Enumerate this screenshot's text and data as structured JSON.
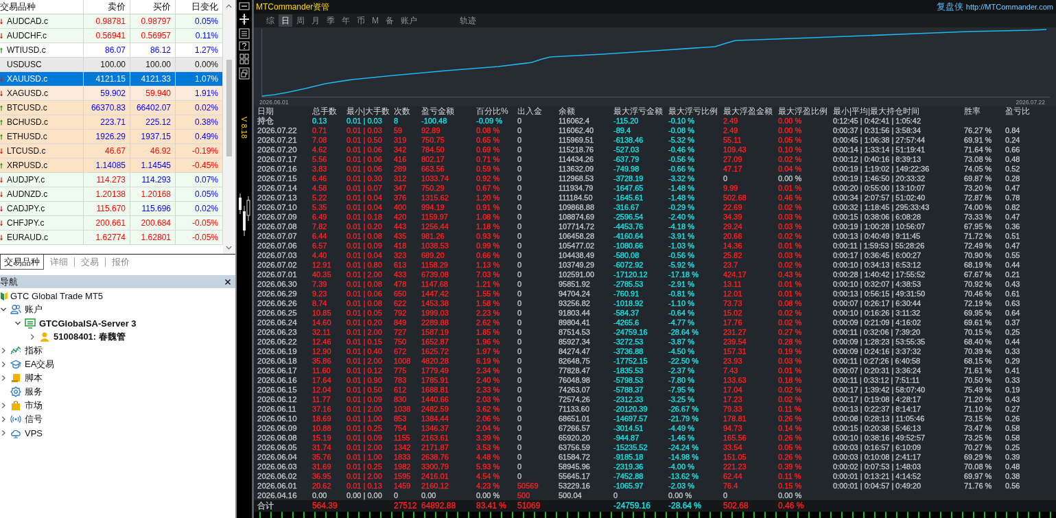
{
  "market_watch": {
    "columns": [
      "交易品种",
      "卖价",
      "买价",
      "日变化"
    ],
    "rows": [
      {
        "symbol": "AUDCAD.c",
        "bid": {
          "text": "0.98781",
          "color": "#ff0000"
        },
        "ask": {
          "text": "0.98797",
          "color": "#ff0000"
        },
        "change": {
          "text": "0.05%",
          "color": "#0000ff"
        },
        "rising": false,
        "color": "#eefbee",
        "selected": false
      },
      {
        "symbol": "AUDCHF.c",
        "bid": {
          "text": "0.56941",
          "color": "#ff0000"
        },
        "ask": {
          "text": "0.56957",
          "color": "#ff0000"
        },
        "change": {
          "text": "0.11%",
          "color": "#0000ff"
        },
        "rising": false,
        "color": "#eefbee",
        "selected": false
      },
      {
        "symbol": "WTIUSD.c",
        "bid": {
          "text": "86.07",
          "color": "#0000ff"
        },
        "ask": {
          "text": "86.12",
          "color": "#0000ff"
        },
        "change": {
          "text": "1.27%",
          "color": "#0000ff"
        },
        "rising": true,
        "color": "#ffffff",
        "selected": false
      },
      {
        "symbol": "USDUSC",
        "bid": {
          "text": "100.00",
          "color": "#111111"
        },
        "ask": {
          "text": "100.00",
          "color": "#111111"
        },
        "change": {
          "text": "0.00%",
          "color": "#111111"
        },
        "color": "#e8e8e8",
        "selected": false
      },
      {
        "symbol": "XAUUSD.c",
        "bid": "4121.15",
        "ask": "4121.33",
        "change": "1.07%",
        "rising": false,
        "selected": true
      },
      {
        "symbol": "XAGUSD.c",
        "bid": {
          "text": "59.902",
          "color": "#0000ff"
        },
        "ask": {
          "text": "59.940",
          "color": "#ff0000"
        },
        "change": {
          "text": "1.91%",
          "color": "#0000ff"
        },
        "rising": false,
        "color": "#fbe9da",
        "selected": false
      },
      {
        "symbol": "BTCUSD.c",
        "bid": {
          "text": "66370.83",
          "color": "#0000ff"
        },
        "ask": {
          "text": "66402.07",
          "color": "#0000ff"
        },
        "change": {
          "text": "0.02%",
          "color": "#0000ff"
        },
        "rising": true,
        "color": "#fde3c6",
        "selected": false
      },
      {
        "symbol": "BCHUSD.c",
        "bid": {
          "text": "223.71",
          "color": "#0000ff"
        },
        "ask": {
          "text": "225.12",
          "color": "#0000ff"
        },
        "change": {
          "text": "0.38%",
          "color": "#0000ff"
        },
        "rising": true,
        "color": "#fde3c6",
        "selected": false
      },
      {
        "symbol": "ETHUSD.c",
        "bid": {
          "text": "1926.29",
          "color": "#0000ff"
        },
        "ask": {
          "text": "1937.15",
          "color": "#0000ff"
        },
        "change": {
          "text": "0.49%",
          "color": "#0000ff"
        },
        "rising": true,
        "color": "#fde3c6",
        "selected": false
      },
      {
        "symbol": "LTCUSD.c",
        "bid": {
          "text": "46.67",
          "color": "#ff0000"
        },
        "ask": {
          "text": "46.92",
          "color": "#ff0000"
        },
        "change": {
          "text": "-0.19%",
          "color": "#ff0000"
        },
        "rising": false,
        "color": "#fde3c6",
        "selected": false
      },
      {
        "symbol": "XRPUSD.c",
        "bid": {
          "text": "1.14085",
          "color": "#0000ff"
        },
        "ask": {
          "text": "1.14545",
          "color": "#0000ff"
        },
        "change": {
          "text": "-0.45%",
          "color": "#ff0000"
        },
        "rising": true,
        "color": "#fde3c6",
        "selected": false
      },
      {
        "symbol": "AUDJPY.c",
        "bid": {
          "text": "114.273",
          "color": "#ff0000"
        },
        "ask": {
          "text": "114.293",
          "color": "#0000ff"
        },
        "change": {
          "text": "0.07%",
          "color": "#0000ff"
        },
        "rising": false,
        "color": "#eefbee",
        "selected": false
      },
      {
        "symbol": "AUDNZD.c",
        "bid": {
          "text": "1.20138",
          "color": "#ff0000"
        },
        "ask": {
          "text": "1.20168",
          "color": "#ff0000"
        },
        "change": {
          "text": "0.05%",
          "color": "#0000ff"
        },
        "rising": false,
        "color": "#eefbee",
        "selected": false
      },
      {
        "symbol": "CADJPY.c",
        "bid": {
          "text": "115.670",
          "color": "#ff0000"
        },
        "ask": {
          "text": "115.696",
          "color": "#0000ff"
        },
        "change": {
          "text": "0.02%",
          "color": "#0000ff"
        },
        "rising": false,
        "color": "#eefbee",
        "selected": false
      },
      {
        "symbol": "CHFJPY.c",
        "bid": {
          "text": "200.661",
          "color": "#ff0000"
        },
        "ask": {
          "text": "200.684",
          "color": "#ff0000"
        },
        "change": {
          "text": "-0.05%",
          "color": "#ff0000"
        },
        "rising": false,
        "color": "#eefbee",
        "selected": false
      },
      {
        "symbol": "EURAUD.c",
        "bid": {
          "text": "1.62774",
          "color": "#ff0000"
        },
        "ask": {
          "text": "1.62801",
          "color": "#ff0000"
        },
        "change": {
          "text": "-0.05%",
          "color": "#ff0000"
        },
        "rising": false,
        "color": "#eefbee",
        "selected": false
      }
    ]
  },
  "market_tabs": [
    {
      "label": "交易品种",
      "selected": true
    },
    {
      "label": "详细",
      "selected": false
    },
    {
      "label": "交易",
      "selected": false
    },
    {
      "label": "报价",
      "selected": false
    }
  ],
  "navigator": {
    "title": "导航",
    "tree": [
      {
        "label": "GTC Global Trade MT5",
        "kind": "broker",
        "children": [
          {
            "label": "账户",
            "kind": "accounts",
            "expanded": true,
            "children": [
              {
                "label": "GTCGlobalSA-Server 3",
                "kind": "server",
                "expanded": true,
                "children": [
                  {
                    "label": "51008401: 春魏管",
                    "kind": "account",
                    "expanded": false
                  }
                ]
              }
            ]
          },
          {
            "label": "指标",
            "kind": "indicators",
            "expanded": false
          },
          {
            "label": "EA交易",
            "kind": "experts",
            "expanded": false
          },
          {
            "label": "脚本",
            "kind": "scripts",
            "expanded": false
          },
          {
            "label": "服务",
            "kind": "services"
          },
          {
            "label": "市场",
            "kind": "market",
            "expanded": false
          },
          {
            "label": "信号",
            "kind": "signals",
            "expanded": false
          },
          {
            "label": "VPS",
            "kind": "vps",
            "expanded": false
          }
        ]
      }
    ]
  },
  "version": "V 8.18",
  "commander": {
    "title": "MTCommander资管",
    "brand": "复盘侠",
    "url": "http://MTCommander.com",
    "tabs": [
      {
        "label": "综",
        "selected": false
      },
      {
        "label": "日",
        "selected": true
      },
      {
        "label": "周",
        "selected": false
      },
      {
        "label": "月",
        "selected": false
      },
      {
        "label": "季",
        "selected": false
      },
      {
        "label": "年",
        "selected": false
      },
      {
        "label": "币",
        "selected": false
      },
      {
        "label": "M",
        "selected": false
      },
      {
        "label": "备",
        "selected": false
      },
      {
        "label": "账户",
        "selected": false
      }
    ],
    "trail_tab": {
      "label": "轨迹",
      "selected": false
    },
    "chart": {
      "start_label": "2026.06.01",
      "end_label": "2026.07.22"
    },
    "table": {
      "columns": [
        {
          "label": "日期"
        },
        {
          "label": "总手数",
          "color": "#ff2121"
        },
        {
          "label": "最小|大手数",
          "color": "#ff2121"
        },
        {
          "label": "次数",
          "color": "#ff2121"
        },
        {
          "label": "盈亏金额",
          "color": "#ff2121"
        },
        {
          "label": "百分比%",
          "color": "#ff2121"
        },
        {
          "label": "出入金"
        },
        {
          "label": "余额"
        },
        {
          "label": "最大浮亏金额",
          "color": "#1fe3e3"
        },
        {
          "label": "最大浮亏比例",
          "color": "#1fe3e3"
        },
        {
          "label": "最大浮盈金额",
          "color": "#ff2121"
        },
        {
          "label": "最大浮盈比例",
          "color": "#ff2121"
        },
        {
          "label": "最小|平均|最大持仓时间"
        },
        {
          "label": "胜率"
        },
        {
          "label": "盈亏比"
        }
      ],
      "rows": [
        {
          "cells": [
            "持仓",
            {
              "text": "0.13",
              "color": "#1fe3e3"
            },
            {
              "text": "0.01 | 0.03",
              "color": "#1fe3e3"
            },
            {
              "text": "8",
              "color": "#1fe3e3"
            },
            {
              "text": "-100.48",
              "color": "#1fe3e3"
            },
            {
              "text": "-0.09 %",
              "color": "#1fe3e3"
            },
            "0",
            "116062.4",
            "-115.20",
            "-0.10 %",
            "2.49",
            "0.00 %",
            "0:12:45 | 0:42:41 | 1:05:42"
          ]
        },
        {
          "cells": [
            "2026.07.22",
            "0.71",
            "0.01 | 0.03",
            "59",
            "92.89",
            "0.08 %",
            "0",
            "116062.40",
            "-89.4",
            "-0.08 %",
            "2.49",
            "0.00 %",
            "0:00:37 | 0:31:56 | 3:58:34",
            "76.27 %",
            "0.84"
          ]
        },
        {
          "cells": [
            "2026.07.21",
            "7.08",
            "0.01 | 0.50",
            "319",
            "750.75",
            "0.65 %",
            "0",
            "115969.51",
            "-6138.46",
            "-5.32 %",
            "55.11",
            "0.05 %",
            "0:00:45 | 1:06:38 | 27:57:44",
            "69.91 %",
            "0.24"
          ]
        },
        {
          "cells": [
            "2026.07.20",
            "4.62",
            "0.01 | 0.06",
            "342",
            "784.50",
            "0.69 %",
            "0",
            "115218.76",
            "-527.03",
            "-0.46 %",
            "109.43",
            "0.10 %",
            "0:00:14 | 1:33:14 | 51:19:41",
            "71.64 %",
            "0.66"
          ]
        },
        {
          "cells": [
            "2026.07.17",
            "5.56",
            "0.01 | 0.06",
            "416",
            "802.17",
            "0.71 %",
            "0",
            "114434.26",
            "-637.79",
            "-0.56 %",
            "27.09",
            "0.02 %",
            "0:00:12 | 0:40:16 | 8:39:13",
            "73.08 %",
            "0.48"
          ]
        },
        {
          "cells": [
            "2026.07.16",
            "3.83",
            "0.01 | 0.06",
            "289",
            "663.56",
            "0.59 %",
            "0",
            "113632.09",
            "-749.98",
            "-0.66 %",
            "47.17",
            "0.04 %",
            "0:00:19 | 1:19:02 | 149:22:36",
            "74.05 %",
            "0.52"
          ]
        },
        {
          "cells": [
            "2026.07.15",
            "6.46",
            "0.01 | 0.30",
            "312",
            "1033.74",
            "0.92 %",
            "0",
            "112968.53",
            "-3728.19",
            "-3.32 %",
            {
              "text": "0",
              "color": "#c2c6cb"
            },
            {
              "text": "0.00 %",
              "color": "#c2c6cb"
            },
            "0:00:19 | 1:46:50 | 20:33:32",
            "69.87 %",
            "0.28"
          ]
        },
        {
          "cells": [
            "2026.07.14",
            "4.58",
            "0.01 | 0.07",
            "347",
            "750.29",
            "0.67 %",
            "0",
            "111934.79",
            "-1647.65",
            "-1.48 %",
            "9.99",
            "0.01 %",
            "0:00:20 | 0:55:00 | 13:10:07",
            "73.20 %",
            "0.47"
          ]
        },
        {
          "cells": [
            "2026.07.13",
            "5.22",
            "0.01 | 0.04",
            "376",
            "1315.62",
            "1.20 %",
            "0",
            "111184.50",
            "-1645.61",
            "-1.48 %",
            "502.68",
            "0.46 %",
            "0:00:34 | 2:07:57 | 51:02:40",
            "72.87 %",
            "0.78"
          ]
        },
        {
          "cells": [
            "2026.07.10",
            "5.35",
            "0.01 | 0.04",
            "400",
            "994.19",
            "0.91 %",
            "0",
            "109868.88",
            "-316.67",
            "-0.29 %",
            "22.69",
            "0.02 %",
            "0:00:32 | 1:18:45 | 295:33:43",
            "74.00 %",
            "0.82"
          ]
        },
        {
          "cells": [
            "2026.07.09",
            "6.49",
            "0.01 | 0.18",
            "420",
            "1159.97",
            "1.08 %",
            "0",
            "108874.69",
            "-2596.54",
            "-2.40 %",
            "34.39",
            "0.03 %",
            "0:00:15 | 0:38:06 | 6:08:28",
            "73.33 %",
            "0.47"
          ]
        },
        {
          "cells": [
            "2026.07.08",
            "7.82",
            "0.01 | 0.20",
            "443",
            "1256.44",
            "1.18 %",
            "0",
            "107714.72",
            "-4453.76",
            "-4.18 %",
            "29.24",
            "0.03 %",
            "0:00:19 | 1:00:28 | 10:56:07",
            "67.95 %",
            "0.36"
          ]
        },
        {
          "cells": [
            "2026.07.07",
            "6.44",
            "0.01 | 0.08",
            "435",
            "981.26",
            "0.93 %",
            "0",
            "106458.28",
            "-4160.64",
            "-3.91 %",
            "20.66",
            "0.02 %",
            "0:00:13 | 0:40:49 | 9:11:45",
            "71.72 %",
            "0.51"
          ]
        },
        {
          "cells": [
            "2026.07.06",
            "6.57",
            "0.01 | 0.09",
            "418",
            "1038.53",
            "0.99 %",
            "0",
            "105477.02",
            "-1080.66",
            "-1.03 %",
            "14.36",
            "0.01 %",
            "0:00:11 | 1:59:53 | 55:28:26",
            "72.49 %",
            "0.47"
          ]
        },
        {
          "cells": [
            "2026.07.03",
            "4.40",
            "0.01 | 0.04",
            "323",
            "689.20",
            "0.66 %",
            "0",
            "104438.49",
            "-580.08",
            "-0.56 %",
            "25.82",
            "0.03 %",
            "0:00:17 | 0:36:45 | 6:00:27",
            "70.90 %",
            "0.55"
          ]
        },
        {
          "cells": [
            "2026.07.02",
            "12.91",
            "0.01 | 0.80",
            "613",
            "1158.29",
            "1.13 %",
            "0",
            "103749.29",
            "-6072.92",
            "-5.92 %",
            "23.7",
            "0.02 %",
            "0:00:10 | 0:34:13 | 6:53:12",
            "68.19 %",
            "0.44"
          ]
        },
        {
          "cells": [
            "2026.07.01",
            "40.35",
            "0.01 | 2.00",
            "433",
            "6739.08",
            "7.03 %",
            "0",
            "102591.00",
            "-17120.12",
            "-17.18 %",
            "424.17",
            "0.43 %",
            "0:00:28 | 1:40:42 | 17:55:52",
            "67.67 %",
            "0.21"
          ]
        },
        {
          "cells": [
            "2026.06.30",
            "7.39",
            "0.01 | 0.08",
            "478",
            "1147.68",
            "1.21 %",
            "0",
            "95851.92",
            "-2785.53",
            "-2.91 %",
            "13.11",
            "0.01 %",
            "0:00:10 | 0:32:07 | 4:38:53",
            "70.92 %",
            "0.43"
          ]
        },
        {
          "cells": [
            "2026.06.29",
            "9.23",
            "0.01 | 0.06",
            "650",
            "1447.42",
            "1.55 %",
            "0",
            "94704.24",
            "-760.91",
            "-0.81 %",
            "12.01",
            "0.01 %",
            "0:00:13 | 0:56:15 | 49:31:50",
            "70.46 %",
            "0.61"
          ]
        },
        {
          "cells": [
            "2026.06.26",
            "8.74",
            "0.01 | 0.08",
            "622",
            "1453.38",
            "1.58 %",
            "0",
            "93256.82",
            "-1018.92",
            "-1.10 %",
            "73.73",
            "0.08 %",
            "0:00:07 | 0:26:17 | 6:30:44",
            "72.19 %",
            "0.63"
          ]
        },
        {
          "cells": [
            "2026.06.25",
            "10.85",
            "0.01 | 0.05",
            "792",
            "1999.03",
            "2.23 %",
            "0",
            "91803.44",
            "-584.37",
            "-0.64 %",
            "15.02",
            "0.02 %",
            "0:00:10 | 0:16:26 | 3:11:32",
            "69.95 %",
            "0.64"
          ]
        },
        {
          "cells": [
            "2026.06.24",
            "14.60",
            "0.01 | 0.20",
            "849",
            "2289.88",
            "2.62 %",
            "0",
            "89804.41",
            "-4265.6",
            "-4.77 %",
            "17.76",
            "0.02 %",
            "0:00:09 | 0:21:09 | 4:16:02",
            "69.61 %",
            "0.37"
          ]
        },
        {
          "cells": [
            "2026.06.23",
            "32.11",
            "0.01 | 2.00",
            "727",
            "1587.19",
            "1.85 %",
            "0",
            "87514.53",
            "-24759.16",
            "-28.64 %",
            "231.27",
            "0.27 %",
            "0:00:11 | 0:32:06 | 7:39:20",
            "70.15 %",
            "0.25"
          ]
        },
        {
          "cells": [
            "2026.06.22",
            "12.46",
            "0.01 | 0.15",
            "750",
            "1652.87",
            "1.96 %",
            "0",
            "85927.34",
            "-3272.53",
            "-3.87 %",
            "239.54",
            "0.28 %",
            "0:00:09 | 1:28:23 | 53:55:35",
            "68.40 %",
            "0.44"
          ]
        },
        {
          "cells": [
            "2026.06.19",
            "12.90",
            "0.01 | 0.40",
            "672",
            "1625.72",
            "1.97 %",
            "0",
            "84274.47",
            "-3736.88",
            "-4.50 %",
            "157.31",
            "0.19 %",
            "0:00:09 | 0:24:16 | 3:37:32",
            "70.39 %",
            "0.33"
          ]
        },
        {
          "cells": [
            "2026.06.18",
            "35.86",
            "0.01 | 2.00",
            "1008",
            "4820.28",
            "6.19 %",
            "0",
            "82648.75",
            "-17752.15",
            "-22.50 %",
            "23.93",
            "0.03 %",
            "0:00:11 | 0:27:26 | 6:40:58",
            "68.15 %",
            "0.29"
          ]
        },
        {
          "cells": [
            "2026.06.17",
            "11.60",
            "0.01 | 0.12",
            "775",
            "1779.49",
            "2.34 %",
            "0",
            "77828.47",
            "-1835.53",
            "-2.37 %",
            "7.43",
            "0.01 %",
            "0:00:07 | 0:20:31 | 3:36:24",
            "71.61 %",
            "0.41"
          ]
        },
        {
          "cells": [
            "2026.06.16",
            "17.64",
            "0.01 | 0.90",
            "783",
            "1785.91",
            "2.40 %",
            "0",
            "76048.98",
            "-5798.53",
            "-7.80 %",
            "133.63",
            "0.18 %",
            "0:00:11 | 0:33:12 | 7:51:11",
            "70.50 %",
            "0.33"
          ]
        },
        {
          "cells": [
            "2026.06.15",
            "12.04",
            "0.01 | 0.50",
            "612",
            "1688.81",
            "2.33 %",
            "0",
            "74263.07",
            "-5788.37",
            "-7.95 %",
            "17.04",
            "0.02 %",
            "0:00:17 | 1:39:42 | 58:07:40",
            "75.49 %",
            "0.19"
          ]
        },
        {
          "cells": [
            "2026.06.12",
            "11.77",
            "0.01 | 0.09",
            "830",
            "1440.66",
            "2.03 %",
            "0",
            "72574.26",
            "-2312.33",
            "-3.25 %",
            "17.23",
            "0.02 %",
            "0:00:17 | 0:19:08 | 4:28:17",
            "71.20 %",
            "0.43"
          ]
        },
        {
          "cells": [
            "2026.06.11",
            "37.16",
            "0.01 | 2.00",
            "1038",
            "2482.59",
            "3.62 %",
            "0",
            "71133.60",
            "-20120.39",
            "-26.67 %",
            "79.33",
            "0.11 %",
            "0:00:13 | 0:22:37 | 8:14:17",
            "71.10 %",
            "0.27"
          ]
        },
        {
          "cells": [
            "2026.06.10",
            "18.69",
            "0.01 | 1.00",
            "853",
            "1384.44",
            "2.06 %",
            "0",
            "68651.01",
            "-14697.57",
            "-21.79 %",
            "178.81",
            "0.26 %",
            "0:00:08 | 0:28:13 | 11:05:46",
            "73.15 %",
            "0.26"
          ]
        },
        {
          "cells": [
            "2026.06.09",
            "10.88",
            "0.01 | 0.25",
            "754",
            "1346.37",
            "2.04 %",
            "0",
            "67266.57",
            "-3014.51",
            "-4.49 %",
            "94.73",
            "0.14 %",
            "0:00:15 | 0:20:38 | 5:46:13",
            "73.47 %",
            "0.58"
          ]
        },
        {
          "cells": [
            "2026.06.08",
            "15.19",
            "0.01 | 0.09",
            "1155",
            "2163.61",
            "3.39 %",
            "0",
            "65920.20",
            "-944.87",
            "-1.46 %",
            "165.56",
            "0.26 %",
            "0:00:10 | 0:38:16 | 49:52:57",
            "73.25 %",
            "0.58"
          ]
        },
        {
          "cells": [
            "2026.06.05",
            "31.74",
            "0.01 | 2.00",
            "1342",
            "2171.87",
            "3.53 %",
            "0",
            "63756.59",
            "-15235.52",
            "-24.24 %",
            "33.54",
            "0.05 %",
            "0:00:03 | 0:16:57 | 6:10:09",
            "70.27 %",
            "0.25"
          ]
        },
        {
          "cells": [
            "2026.06.04",
            "35.76",
            "0.01 | 1.00",
            "1833",
            "2638.76",
            "4.48 %",
            "0",
            "61584.72",
            "-9185.18",
            "-14.98 %",
            "151.05",
            "0.26 %",
            "0:00:03 | 0:10:08 | 2:41:17",
            "69.29 %",
            "0.39"
          ]
        },
        {
          "cells": [
            "2026.06.03",
            "31.69",
            "0.01 | 0.25",
            "1982",
            "3300.79",
            "5.93 %",
            "0",
            "58945.96",
            "-2319.36",
            "-4.00 %",
            "221.23",
            "0.39 %",
            "0:00:02 | 0:07:53 | 1:48:03",
            "70.08 %",
            "0.48"
          ]
        },
        {
          "cells": [
            "2026.06.02",
            "36.95",
            "0.01 | 2.00",
            "1595",
            "2416.01",
            "4.54 %",
            "0",
            "55645.17",
            "-7452.88",
            "-13.62 %",
            "62.44",
            "0.11 %",
            "0:00:01 | 0:13:21 | 4:14:52",
            "69.97 %",
            "0.38"
          ]
        },
        {
          "cells": [
            "2026.06.01",
            "20.62",
            "0.01 | 0.13",
            "1459",
            "2160.12",
            "4.23 %",
            {
              "text": "50569",
              "color": "#ff2121"
            },
            "53229.16",
            "-1065.97",
            "-2.03 %",
            "76.4",
            "0.15 %",
            "0:00:01 | 0:04:57 | 0:49:20",
            "71.76 %",
            "0.56"
          ]
        },
        {
          "cells": [
            "2026.04.16",
            {
              "text": "0.00",
              "color": "#c2c6cb"
            },
            {
              "text": "0.00 | 0.00",
              "color": "#c2c6cb"
            },
            {
              "text": "0",
              "color": "#c2c6cb"
            },
            {
              "text": "0.00",
              "color": "#c2c6cb"
            },
            {
              "text": "0.00 %",
              "color": "#c2c6cb"
            },
            {
              "text": "500",
              "color": "#ff2121"
            },
            "500.04",
            {
              "text": "0",
              "color": "#c2c6cb"
            },
            {
              "text": "0.00 %",
              "color": "#c2c6cb"
            },
            {
              "text": "0",
              "color": "#c2c6cb"
            },
            {
              "text": "0.00 %",
              "color": "#c2c6cb"
            }
          ]
        }
      ],
      "totals": {
        "label": "合计",
        "total_lots": {
          "text": "564.39",
          "color": "#ff2121"
        },
        "trades": {
          "text": "27512",
          "color": "#ff2121"
        },
        "pnl": {
          "text": "64892.88",
          "color": "#ff2121"
        },
        "pct": {
          "text": "83.41 %",
          "color": "#ff2121"
        },
        "deposits": {
          "text": "51069",
          "color": "#ff2121"
        },
        "max_float_loss": {
          "text": "-24759.16",
          "color": "#1fe3e3"
        },
        "max_float_loss_pct": {
          "text": "-28.64 %",
          "color": "#1fe3e3"
        },
        "max_float_profit": {
          "text": "502.68",
          "color": "#ff2121"
        },
        "max_float_profit_pct": {
          "text": "0.46 %",
          "color": "#ff2121"
        }
      }
    }
  }
}
